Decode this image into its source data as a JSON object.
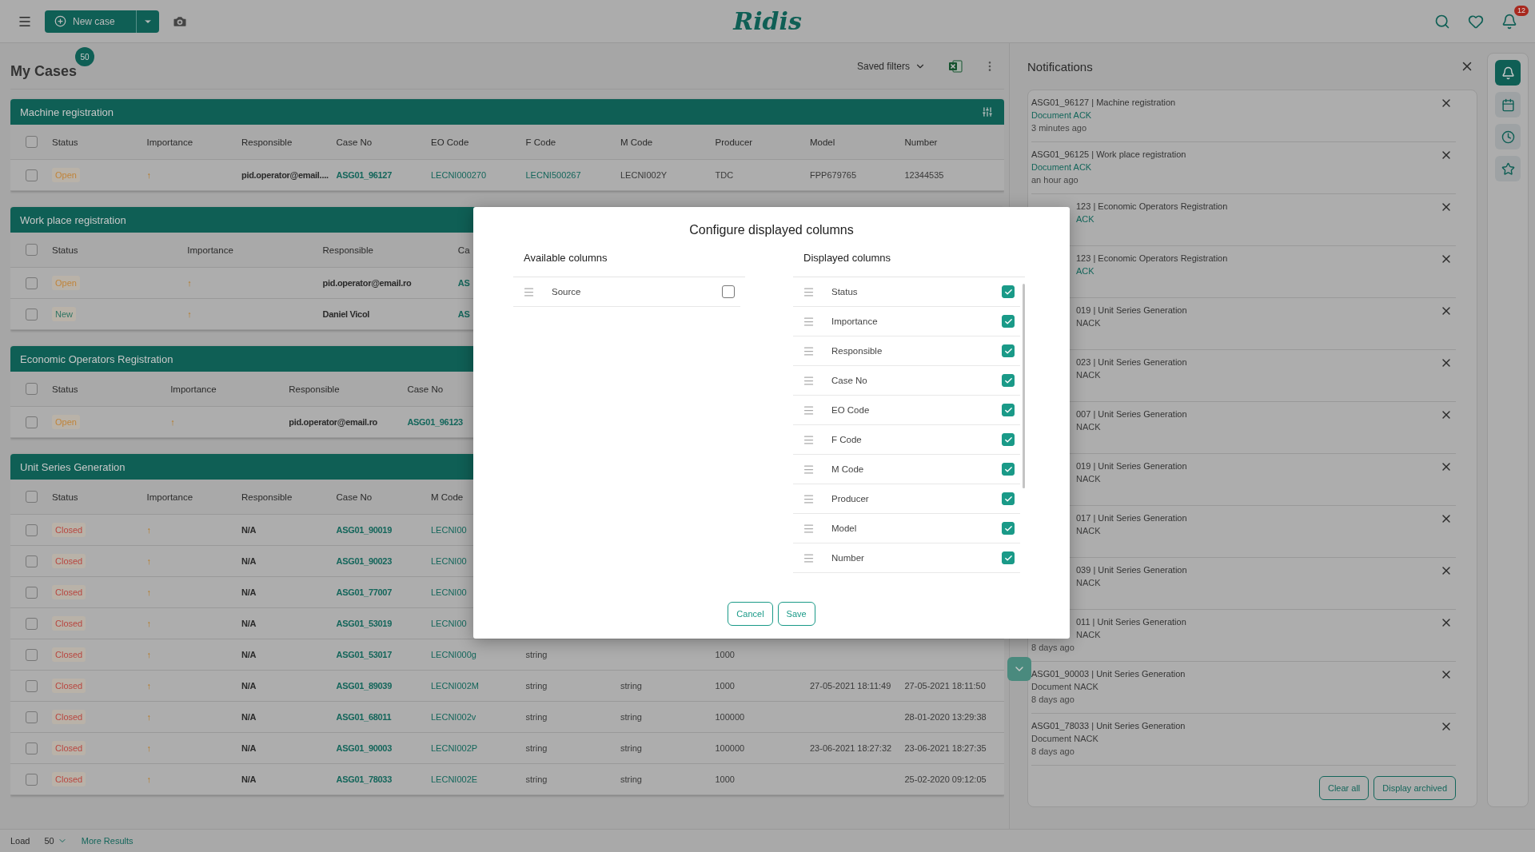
{
  "top_bar": {
    "new_case_button": "New case",
    "logo": "Ridis",
    "notification_count": "12"
  },
  "cases": {
    "title": "My Cases",
    "count": "50",
    "saved_filters": "Saved filters"
  },
  "tables": [
    {
      "title": "Machine registration",
      "all_checked": false,
      "columns": [
        "Status",
        "Importance",
        "Responsible",
        "Case No",
        "EO Code",
        "F Code",
        "M Code",
        "Producer",
        "Model",
        "Number"
      ],
      "rows": [
        {
          "checked": false,
          "cells": [
            {
              "text": "Open",
              "kind": "status",
              "color": "#c0843a"
            },
            {
              "text": "↑",
              "kind": "importance"
            },
            {
              "text": "pid.operator@email....",
              "kind": "bold"
            },
            {
              "text": "ASG01_96127",
              "kind": "link"
            },
            {
              "text": "LECNI000270",
              "kind": "code"
            },
            {
              "text": "LECNI500267",
              "kind": "code"
            },
            {
              "text": "LECNI002Y",
              "kind": "plain"
            },
            {
              "text": "TDC",
              "kind": "plain"
            },
            {
              "text": "FPP679765",
              "kind": "plain"
            },
            {
              "text": "12344535",
              "kind": "plain"
            }
          ]
        }
      ]
    },
    {
      "title": "Work place registration",
      "all_checked": false,
      "columns": [
        "Status",
        "Importance",
        "Responsible",
        "Ca"
      ],
      "rows": [
        {
          "checked": false,
          "cells": [
            {
              "text": "Open",
              "kind": "status",
              "color": "#c0843a"
            },
            {
              "text": "↑",
              "kind": "importance"
            },
            {
              "text": "pid.operator@email.ro",
              "kind": "bold"
            },
            {
              "text": "AS",
              "kind": "link"
            }
          ]
        },
        {
          "checked": false,
          "cells": [
            {
              "text": "New",
              "kind": "status",
              "color": "#2f7563"
            },
            {
              "text": "↑",
              "kind": "importance"
            },
            {
              "text": "Daniel Vicol",
              "kind": "bold"
            },
            {
              "text": "AS",
              "kind": "link"
            }
          ]
        }
      ]
    },
    {
      "title": "Economic Operators Registration",
      "all_checked": false,
      "columns": [
        "Status",
        "Importance",
        "Responsible",
        "Case No"
      ],
      "rows": [
        {
          "checked": false,
          "cells": [
            {
              "text": "Open",
              "kind": "status",
              "color": "#c0843a"
            },
            {
              "text": "↑",
              "kind": "importance"
            },
            {
              "text": "pid.operator@email.ro",
              "kind": "bold"
            },
            {
              "text": "ASG01_96123",
              "kind": "link"
            }
          ]
        }
      ]
    },
    {
      "title": "Unit Series Generation",
      "all_checked": false,
      "columns": [
        "Status",
        "Importance",
        "Responsible",
        "Case No",
        "M Code"
      ],
      "rows": [
        {
          "checked": false,
          "cells": [
            {
              "text": "Closed",
              "kind": "status",
              "color": "#b8453f"
            },
            {
              "text": "↑",
              "kind": "importance"
            },
            {
              "text": "N/A",
              "kind": "bold"
            },
            {
              "text": "ASG01_90019",
              "kind": "link"
            },
            {
              "text": "LECNI00",
              "kind": "code"
            }
          ]
        },
        {
          "checked": false,
          "cells": [
            {
              "text": "Closed",
              "kind": "status",
              "color": "#b8453f"
            },
            {
              "text": "↑",
              "kind": "importance"
            },
            {
              "text": "N/A",
              "kind": "bold"
            },
            {
              "text": "ASG01_90023",
              "kind": "link"
            },
            {
              "text": "LECNI00",
              "kind": "code"
            }
          ]
        },
        {
          "checked": false,
          "cells": [
            {
              "text": "Closed",
              "kind": "status",
              "color": "#b8453f"
            },
            {
              "text": "↑",
              "kind": "importance"
            },
            {
              "text": "N/A",
              "kind": "bold"
            },
            {
              "text": "ASG01_77007",
              "kind": "link"
            },
            {
              "text": "LECNI00",
              "kind": "code"
            }
          ]
        },
        {
          "checked": false,
          "cells": [
            {
              "text": "Closed",
              "kind": "status",
              "color": "#b8453f"
            },
            {
              "text": "↑",
              "kind": "importance"
            },
            {
              "text": "N/A",
              "kind": "bold"
            },
            {
              "text": "ASG01_53019",
              "kind": "link"
            },
            {
              "text": "LECNI00",
              "kind": "code"
            }
          ]
        },
        {
          "checked": false,
          "cells": [
            {
              "text": "Closed",
              "kind": "status",
              "color": "#b8453f"
            },
            {
              "text": "↑",
              "kind": "importance"
            },
            {
              "text": "N/A",
              "kind": "bold"
            },
            {
              "text": "ASG01_53017",
              "kind": "link"
            },
            {
              "text": "LECNI000g",
              "kind": "code"
            },
            {
              "text": "string",
              "kind": "plain"
            },
            null,
            {
              "text": "1000",
              "kind": "plain"
            },
            null,
            null
          ]
        },
        {
          "checked": false,
          "cells": [
            {
              "text": "Closed",
              "kind": "status",
              "color": "#b8453f"
            },
            {
              "text": "↑",
              "kind": "importance"
            },
            {
              "text": "N/A",
              "kind": "bold"
            },
            {
              "text": "ASG01_89039",
              "kind": "link"
            },
            {
              "text": "LECNI002M",
              "kind": "code"
            },
            {
              "text": "string",
              "kind": "plain"
            },
            {
              "text": "string",
              "kind": "plain"
            },
            {
              "text": "1000",
              "kind": "plain"
            },
            {
              "text": "27-05-2021 18:11:49",
              "kind": "plain"
            },
            {
              "text": "27-05-2021 18:11:50",
              "kind": "plain"
            }
          ]
        },
        {
          "checked": false,
          "cells": [
            {
              "text": "Closed",
              "kind": "status",
              "color": "#b8453f"
            },
            {
              "text": "↑",
              "kind": "importance"
            },
            {
              "text": "N/A",
              "kind": "bold"
            },
            {
              "text": "ASG01_68011",
              "kind": "link"
            },
            {
              "text": "LECNI002v",
              "kind": "code"
            },
            {
              "text": "string",
              "kind": "plain"
            },
            {
              "text": "string",
              "kind": "plain"
            },
            {
              "text": "100000",
              "kind": "plain"
            },
            null,
            {
              "text": "28-01-2020 13:29:38",
              "kind": "plain"
            }
          ]
        },
        {
          "checked": false,
          "cells": [
            {
              "text": "Closed",
              "kind": "status",
              "color": "#b8453f"
            },
            {
              "text": "↑",
              "kind": "importance"
            },
            {
              "text": "N/A",
              "kind": "bold"
            },
            {
              "text": "ASG01_90003",
              "kind": "link"
            },
            {
              "text": "LECNI002P",
              "kind": "code"
            },
            {
              "text": "string",
              "kind": "plain"
            },
            {
              "text": "string",
              "kind": "plain"
            },
            {
              "text": "100000",
              "kind": "plain"
            },
            {
              "text": "23-06-2021 18:27:32",
              "kind": "plain"
            },
            {
              "text": "23-06-2021 18:27:35",
              "kind": "plain"
            }
          ]
        },
        {
          "checked": false,
          "cells": [
            {
              "text": "Closed",
              "kind": "status",
              "color": "#b8453f"
            },
            {
              "text": "↑",
              "kind": "importance"
            },
            {
              "text": "N/A",
              "kind": "bold"
            },
            {
              "text": "ASG01_78033",
              "kind": "link"
            },
            {
              "text": "LECNI002E",
              "kind": "code"
            },
            {
              "text": "string",
              "kind": "plain"
            },
            {
              "text": "string",
              "kind": "plain"
            },
            {
              "text": "1000",
              "kind": "plain"
            },
            null,
            {
              "text": "25-02-2020 09:12:05",
              "kind": "plain"
            }
          ]
        }
      ]
    }
  ],
  "footer": {
    "load_label": "Load",
    "load_count": "50",
    "more_results": "More Results"
  },
  "notifications": {
    "title": "Notifications",
    "items": [
      {
        "title": "ASG01_96127 | Machine registration",
        "message": "Document ACK",
        "ack": true,
        "time": "3 minutes ago"
      },
      {
        "title": "ASG01_96125 | Work place registration",
        "message": "Document ACK",
        "ack": true,
        "time": "an hour ago"
      },
      {
        "title": "123 | Economic Operators Registration",
        "message": "ACK",
        "ack": true,
        "obscured": true
      },
      {
        "title": "123 | Economic Operators Registration",
        "message": "ACK",
        "ack": true,
        "obscured": true
      },
      {
        "title": "019 | Unit Series Generation",
        "message": "NACK",
        "ack": false,
        "obscured": true
      },
      {
        "title": "023 | Unit Series Generation",
        "message": "NACK",
        "ack": false,
        "obscured": true
      },
      {
        "title": "007 | Unit Series Generation",
        "message": "NACK",
        "ack": false,
        "obscured": true
      },
      {
        "title": "019 | Unit Series Generation",
        "message": "NACK",
        "ack": false,
        "obscured": true
      },
      {
        "title": "017 | Unit Series Generation",
        "message": "NACK",
        "ack": false,
        "obscured": true
      },
      {
        "title": "039 | Unit Series Generation",
        "message": "NACK",
        "ack": false,
        "obscured": true
      },
      {
        "title": "011 | Unit Series Generation",
        "message": "NACK",
        "ack": false,
        "time": "8 days ago",
        "obscured": true
      },
      {
        "title": "ASG01_90003 | Unit Series Generation",
        "message": "Document NACK",
        "ack": false,
        "time": "8 days ago"
      },
      {
        "title": "ASG01_78033 | Unit Series Generation",
        "message": "Document NACK",
        "ack": false,
        "time": "8 days ago"
      }
    ],
    "buttons": [
      "Clear all",
      "Display archived"
    ]
  },
  "rail": [
    {
      "kind": "bell",
      "selected": true
    },
    {
      "kind": "calendar",
      "selected": false
    },
    {
      "kind": "clock",
      "selected": false
    },
    {
      "kind": "star",
      "selected": false
    }
  ],
  "modal": {
    "title": "Configure displayed columns",
    "available_title": "Available columns",
    "displayed_title": "Displayed columns",
    "available": [
      {
        "label": "Source",
        "checked": false
      }
    ],
    "displayed": [
      {
        "label": "Status",
        "checked": true
      },
      {
        "label": "Importance",
        "checked": true
      },
      {
        "label": "Responsible",
        "checked": true
      },
      {
        "label": "Case No",
        "checked": true
      },
      {
        "label": "EO Code",
        "checked": true
      },
      {
        "label": "F Code",
        "checked": true
      },
      {
        "label": "M Code",
        "checked": true
      },
      {
        "label": "Producer",
        "checked": true
      },
      {
        "label": "Model",
        "checked": true
      },
      {
        "label": "Number",
        "checked": true
      }
    ],
    "cancel": "Cancel",
    "save": "Save"
  }
}
